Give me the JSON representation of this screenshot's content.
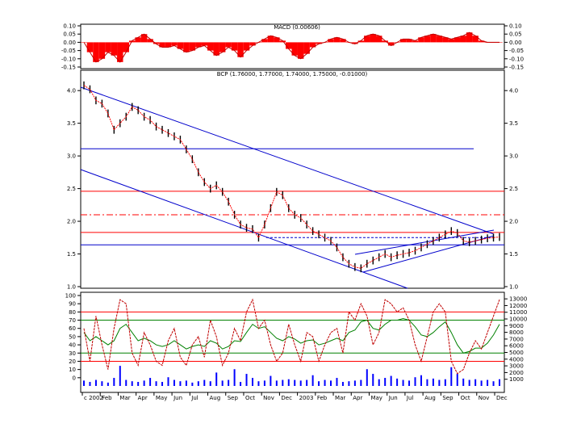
{
  "chart_data": [
    {
      "type": "area",
      "title": "MACD (0.00606)",
      "ylim": [
        -0.15,
        0.1
      ],
      "yticks": [
        "0.10",
        "0.05",
        "0.00",
        "-0.05",
        "-0.10",
        "-0.15"
      ],
      "yticks_values": [
        0.1,
        0.05,
        0.0,
        -0.05,
        -0.1,
        -0.15
      ],
      "grid": false,
      "colors": {
        "histogram": "#ff0000",
        "line": "#c00000"
      },
      "series": [
        {
          "values": [
            0.0,
            -0.06,
            -0.12,
            -0.1,
            -0.06,
            -0.08,
            -0.12,
            -0.06,
            0.01,
            0.03,
            0.05,
            0.02,
            -0.01,
            -0.03,
            -0.03,
            -0.02,
            -0.04,
            -0.06,
            -0.05,
            -0.03,
            -0.02,
            -0.05,
            -0.08,
            -0.06,
            -0.03,
            -0.05,
            -0.09,
            -0.05,
            -0.02,
            0.0,
            0.02,
            0.04,
            0.03,
            0.01,
            -0.04,
            -0.08,
            -0.1,
            -0.07,
            -0.03,
            -0.01,
            0.0,
            0.02,
            0.03,
            0.02,
            0.0,
            -0.01,
            0.01,
            0.04,
            0.05,
            0.04,
            0.01,
            -0.02,
            0.0,
            0.02,
            0.02,
            0.01,
            0.03,
            0.04,
            0.05,
            0.04,
            0.03,
            0.02,
            0.03,
            0.04,
            0.06,
            0.04,
            0.01,
            0.0,
            0.0,
            0.0
          ]
        }
      ]
    },
    {
      "type": "line",
      "title": "BCP (1.76000, 1.77000, 1.74000, 1.75000, -0.01000)",
      "ylim": [
        1.0,
        4.2
      ],
      "yticks": [
        "4.0",
        "3.5",
        "3.0",
        "2.5",
        "2.0",
        "1.5",
        "1.0"
      ],
      "yticks_values": [
        4.0,
        3.5,
        3.0,
        2.5,
        2.0,
        1.5,
        1.0
      ],
      "grid": false,
      "colors": {
        "price": "#000000",
        "close": "#ff0000",
        "channel": "#0000cc",
        "level": "#ff0000"
      },
      "series": [
        {
          "values": [
            4.08,
            4.02,
            3.85,
            3.8,
            3.65,
            3.4,
            3.5,
            3.6,
            3.75,
            3.7,
            3.6,
            3.55,
            3.45,
            3.4,
            3.35,
            3.3,
            3.25,
            3.1,
            2.95,
            2.75,
            2.6,
            2.5,
            2.55,
            2.45,
            2.3,
            2.1,
            1.95,
            1.9,
            1.88,
            1.75,
            1.95,
            2.2,
            2.45,
            2.4,
            2.2,
            2.1,
            2.05,
            1.95,
            1.85,
            1.8,
            1.75,
            1.7,
            1.6,
            1.45,
            1.35,
            1.3,
            1.28,
            1.35,
            1.4,
            1.45,
            1.5,
            1.45,
            1.48,
            1.5,
            1.52,
            1.55,
            1.6,
            1.65,
            1.7,
            1.75,
            1.8,
            1.85,
            1.82,
            1.7,
            1.68,
            1.7,
            1.72,
            1.74,
            1.75,
            1.76
          ]
        }
      ],
      "levels": [
        3.11,
        2.46,
        2.1,
        1.83,
        1.64
      ],
      "dashed_levels": [
        2.1,
        1.75
      ]
    },
    {
      "type": "line",
      "ylim": [
        -10,
        100
      ],
      "yticks_left": [
        "100",
        "90",
        "80",
        "70",
        "60",
        "50",
        "40",
        "30",
        "20",
        "10",
        "0"
      ],
      "yticks_left_values": [
        100,
        90,
        80,
        70,
        60,
        50,
        40,
        30,
        20,
        10,
        0
      ],
      "yticks_right": [
        "13000",
        "12000",
        "11000",
        "10000",
        "9000",
        "8000",
        "7000",
        "6000",
        "5000",
        "4000",
        "3000",
        "2000",
        "1000"
      ],
      "yticks_right_values": [
        13000,
        12000,
        11000,
        10000,
        9000,
        8000,
        7000,
        6000,
        5000,
        4000,
        3000,
        2000,
        1000
      ],
      "y2lim": [
        0,
        13500
      ],
      "levels": [
        80,
        70,
        30,
        20
      ],
      "x_tick_labels": [
        "c 2002",
        "Feb",
        "Mar",
        "Apr",
        "May",
        "Jun",
        "Jul",
        "Aug",
        "Sep",
        "Oct",
        "Nov",
        "Dec",
        "2003",
        "Feb",
        "Mar",
        "Apr",
        "May",
        "Jun",
        "Jul",
        "Aug",
        "Sep",
        "Oct",
        "Nov",
        "Dec"
      ],
      "grid": false,
      "colors": {
        "oscillator": "#c00000",
        "signal": "#008000",
        "volume": "#0000ff"
      },
      "series": [
        {
          "values": [
            60,
            20,
            75,
            40,
            10,
            60,
            95,
            90,
            30,
            15,
            55,
            40,
            20,
            15,
            45,
            60,
            25,
            15,
            40,
            50,
            25,
            70,
            50,
            15,
            30,
            60,
            45,
            80,
            95,
            60,
            70,
            40,
            20,
            30,
            65,
            40,
            20,
            55,
            50,
            20,
            40,
            55,
            60,
            30,
            80,
            70,
            90,
            75,
            40,
            55,
            95,
            90,
            80,
            85,
            70,
            40,
            20,
            50,
            80,
            90,
            80,
            20,
            5,
            10,
            30,
            45,
            35,
            55,
            75,
            95
          ]
        },
        {
          "values": [
            55,
            45,
            50,
            45,
            40,
            45,
            60,
            65,
            55,
            45,
            48,
            45,
            40,
            38,
            40,
            45,
            40,
            35,
            38,
            40,
            38,
            45,
            42,
            35,
            38,
            45,
            44,
            55,
            65,
            60,
            62,
            55,
            48,
            45,
            50,
            47,
            42,
            45,
            46,
            40,
            42,
            45,
            48,
            45,
            55,
            58,
            68,
            70,
            60,
            58,
            65,
            70,
            70,
            72,
            70,
            62,
            52,
            50,
            55,
            62,
            68,
            55,
            40,
            30,
            32,
            36,
            36,
            42,
            52,
            65
          ]
        },
        {
          "values": [
            800,
            600,
            900,
            700,
            500,
            1200,
            3000,
            900,
            700,
            600,
            800,
            1200,
            700,
            600,
            1300,
            900,
            700,
            800,
            500,
            700,
            900,
            700,
            2000,
            800,
            900,
            2500,
            600,
            1800,
            1200,
            700,
            800,
            1500,
            800,
            900,
            1000,
            900,
            800,
            900,
            1600,
            700,
            900,
            800,
            1200,
            600,
            700,
            800,
            900,
            2500,
            1800,
            1000,
            1200,
            1500,
            1100,
            900,
            800,
            1300,
            1600,
            1000,
            1100,
            900,
            1000,
            2800,
            1800,
            1100,
            900,
            1000,
            800,
            900,
            700,
            1000
          ]
        }
      ]
    }
  ]
}
